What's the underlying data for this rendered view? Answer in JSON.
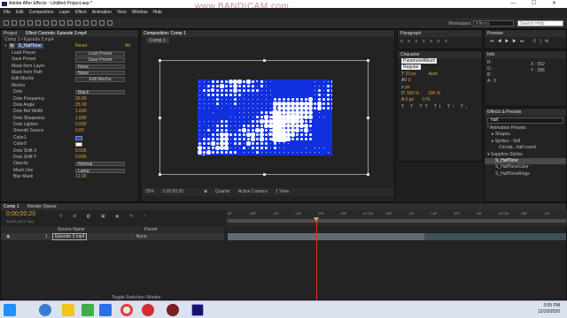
{
  "window": {
    "title": "Adobe After Effects - Untitled Project.aep *",
    "watermark": "www.BANDICAM.com",
    "controls": "— ☐ ✕"
  },
  "menu": [
    "File",
    "Edit",
    "Composition",
    "Layer",
    "Effect",
    "Animation",
    "View",
    "Window",
    "Help"
  ],
  "toolbar": {
    "workspace_label": "Workspace:",
    "workspace_value": "Effects",
    "search_placeholder": "Search Help"
  },
  "left_panel": {
    "tabs": [
      "Project",
      "Effect Controls: Episode 3.mp4"
    ],
    "crumb": "Comp 1 • Episode 3.mp4",
    "fx_name": "S_HalfTone",
    "reset": "Reset",
    "about": "Ab",
    "rows": [
      {
        "label": "Load Preset",
        "kind": "btn",
        "value": "Load Preset"
      },
      {
        "label": "Save Preset",
        "kind": "btn",
        "value": "Save Preset"
      },
      {
        "label": "Mask from Layer",
        "kind": "sel",
        "value": "None"
      },
      {
        "label": "Mask from Path",
        "kind": "sel",
        "value": "None"
      },
      {
        "label": "Edit Mocha",
        "kind": "btn",
        "value": "Edit Mocha"
      },
      {
        "label": "Mocha",
        "kind": "txt",
        "value": ""
      },
      {
        "label": "Dots",
        "kind": "sel",
        "value": "Black"
      },
      {
        "label": "Dots Frequency",
        "kind": "num",
        "value": "20.00"
      },
      {
        "label": "Dots Angle",
        "kind": "num",
        "value": "25.00"
      },
      {
        "label": "Dots Rel Width",
        "kind": "num",
        "value": "1.000"
      },
      {
        "label": "Dots Sharpness",
        "kind": "num",
        "value": "1.000"
      },
      {
        "label": "Dots Lighten",
        "kind": "num",
        "value": "0.000"
      },
      {
        "label": "Smooth Source",
        "kind": "num",
        "value": "0.00"
      },
      {
        "label": "Color1",
        "kind": "color",
        "value": "#2040ff"
      },
      {
        "label": "Color0",
        "kind": "color",
        "value": "#ffffff"
      },
      {
        "label": "Dots Shift X",
        "kind": "num",
        "value": "0.000"
      },
      {
        "label": "Dots Shift Y",
        "kind": "num",
        "value": "0.000"
      },
      {
        "label": "Opacity",
        "kind": "sel",
        "value": "Normal"
      },
      {
        "label": "Mask Use",
        "kind": "sel",
        "value": "Luma"
      },
      {
        "label": "Blur Mask",
        "kind": "num",
        "value": "12.00"
      }
    ]
  },
  "viewer": {
    "tab": "Composition: Comp 1",
    "subtab": "Comp 1",
    "zoom": "25%",
    "timecode": "0;00;00;20",
    "resolution": "Quarter",
    "camera": "Active Camera",
    "views": "1 View"
  },
  "right": {
    "paragraph": {
      "tab": "Paragraph",
      "indent1": "0 px",
      "indent2": "0 px",
      "space1": "0 px",
      "space2": "0 px"
    },
    "preview": {
      "tab": "Preview"
    },
    "character": {
      "tab": "Character",
      "font": "ParamoreAlbum",
      "style": "Regular",
      "size": "23 px",
      "leading": "Auto",
      "tracking": "0",
      "kerning": "px",
      "vscale": "100 %",
      "hscale": "100 %",
      "baseline": "0 px",
      "tsume": "0 %"
    },
    "info": {
      "tab": "Info",
      "r": "R :",
      "g": "G :",
      "b": "B :",
      "a": "A : 0",
      "x": "X : 552",
      "y": "Y : 286"
    },
    "effects": {
      "tab": "Effects & Presets",
      "search": "half",
      "items": [
        "* Animation Presets",
        "▸ Shapes",
        "▸ Sprites - Still",
        "Circula...half round",
        "▾ Sapphire Stylize",
        "S_HalfTone",
        "S_HalfToneColor",
        "S_HalfToneRings"
      ]
    }
  },
  "timeline": {
    "tabs": [
      "Comp 1",
      "Render Queue"
    ],
    "timecode": "0;00;00;20",
    "fps": "00020 (29.97 fps)",
    "cols": [
      "Source Name",
      "Parent"
    ],
    "layer": {
      "num": "1",
      "name": "Episode 3.mp4",
      "parent": "None"
    },
    "ruler": [
      "0F",
      "05F",
      "10F",
      "15F",
      "20F",
      "25F",
      "01:00f",
      "05F",
      "10F",
      "15F",
      "20F",
      "25F",
      "02:00f",
      "05F",
      "10F"
    ],
    "toggle": "Toggle Switches / Modes"
  },
  "taskbar": {
    "time": "3:55 PM",
    "date": "12/20/2020"
  }
}
